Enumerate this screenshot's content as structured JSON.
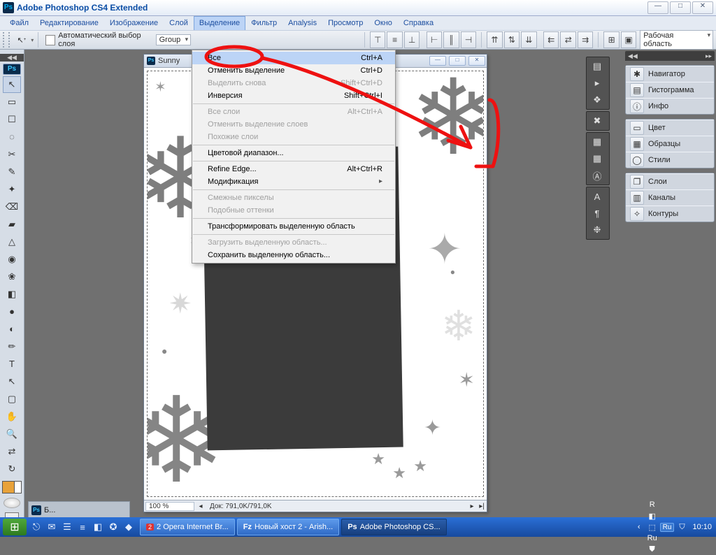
{
  "window": {
    "title": "Adobe Photoshop CS4 Extended"
  },
  "menu": {
    "items": [
      "Файл",
      "Редактирование",
      "Изображение",
      "Слой",
      "Выделение",
      "Фильтр",
      "Analysis",
      "Просмотр",
      "Окно",
      "Справка"
    ],
    "open_index": 4
  },
  "dropdown": {
    "groups": [
      [
        {
          "label": "Все",
          "shortcut": "Ctrl+A",
          "hl": true
        },
        {
          "label": "Отменить выделение",
          "shortcut": "Ctrl+D"
        },
        {
          "label": "Выделить снова",
          "shortcut": "Shift+Ctrl+D",
          "disabled": true
        },
        {
          "label": "Инверсия",
          "shortcut": "Shift+Ctrl+I"
        }
      ],
      [
        {
          "label": "Все слои",
          "shortcut": "Alt+Ctrl+A",
          "disabled": true
        },
        {
          "label": "Отменить выделение слоев",
          "disabled": true
        },
        {
          "label": "Похожие слои",
          "disabled": true
        }
      ],
      [
        {
          "label": "Цветовой диапазон..."
        }
      ],
      [
        {
          "label": "Refine Edge...",
          "shortcut": "Alt+Ctrl+R"
        },
        {
          "label": "Модификация",
          "submenu": true
        }
      ],
      [
        {
          "label": "Смежные пикселы",
          "disabled": true
        },
        {
          "label": "Подобные оттенки",
          "disabled": true
        }
      ],
      [
        {
          "label": "Трансформировать выделенную область"
        }
      ],
      [
        {
          "label": "Загрузить выделенную область...",
          "disabled": true
        },
        {
          "label": "Сохранить выделенную область..."
        }
      ]
    ]
  },
  "options": {
    "auto_select_label": "Автоматический выбор слоя",
    "group": "Group",
    "workspace_label": "Рабочая область"
  },
  "toolbox_icons": [
    "↖",
    "▭",
    "☐",
    "◌",
    "✂",
    "✎",
    "✦",
    "⌫",
    "▰",
    "△",
    "◉",
    "❀",
    "◧",
    "●",
    "◐",
    "✏",
    "T",
    "↖",
    "▢",
    "✋",
    "🔍",
    "⇄",
    "↻"
  ],
  "doc": {
    "title": "Sunny",
    "zoom": "100 %",
    "status": "Док: 791,0K/791,0K"
  },
  "panels": {
    "g1": [
      "Навигатор",
      "Гистограмма",
      "Инфо"
    ],
    "g2": [
      "Цвет",
      "Образцы",
      "Стили"
    ],
    "g3": [
      "Слои",
      "Каналы",
      "Контуры"
    ]
  },
  "panel_icons": {
    "g1": [
      "✱",
      "▤",
      "ⓘ"
    ],
    "g2": [
      "▭",
      "▦",
      "◯"
    ],
    "g3": [
      "❐",
      "▥",
      "✧"
    ]
  },
  "dock_icons": {
    "a": [
      "▤",
      "▸",
      "❖"
    ],
    "b": [
      "✖"
    ],
    "c": [
      "▦",
      "▦",
      "Ⓐ"
    ],
    "d": [
      "A",
      "¶",
      "❉"
    ]
  },
  "bottom_dock": {
    "label": "Б..."
  },
  "taskbar": {
    "quicklaunch_icons": [
      "⎋",
      "✉",
      "☰",
      "≡",
      "◧",
      "✪",
      "◆"
    ],
    "buttons": [
      {
        "icon": "O",
        "label": "2 Opera Internet Br...",
        "badge": "2"
      },
      {
        "icon": "Fz",
        "label": "Новый хост 2 - Arish..."
      },
      {
        "icon": "Ps",
        "label": "Adobe Photoshop CS...",
        "active": true
      }
    ],
    "tray_icons": [
      "R",
      "◧",
      "⬚",
      "Ru",
      "⛊"
    ],
    "lang": "Ru",
    "clock": "10:10"
  }
}
